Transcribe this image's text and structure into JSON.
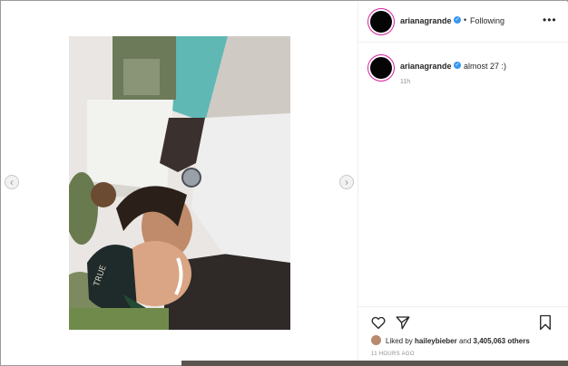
{
  "post": {
    "media": {
      "photo_alt": "selfie photo",
      "prev_arrow": "‹",
      "next_arrow": "›"
    },
    "header": {
      "username": "arianagrande",
      "separator": "•",
      "follow_state": "Following",
      "more": "•••"
    },
    "caption": {
      "username": "arianagrande",
      "text": "almost 27 :)",
      "time": "11h"
    },
    "actions": {
      "liked_by_prefix": "Liked by ",
      "liked_by_user": "haileybieber",
      "liked_by_and": " and ",
      "liked_by_count": "3,405,063 others",
      "timestamp": "11 HOURS AGO"
    }
  }
}
